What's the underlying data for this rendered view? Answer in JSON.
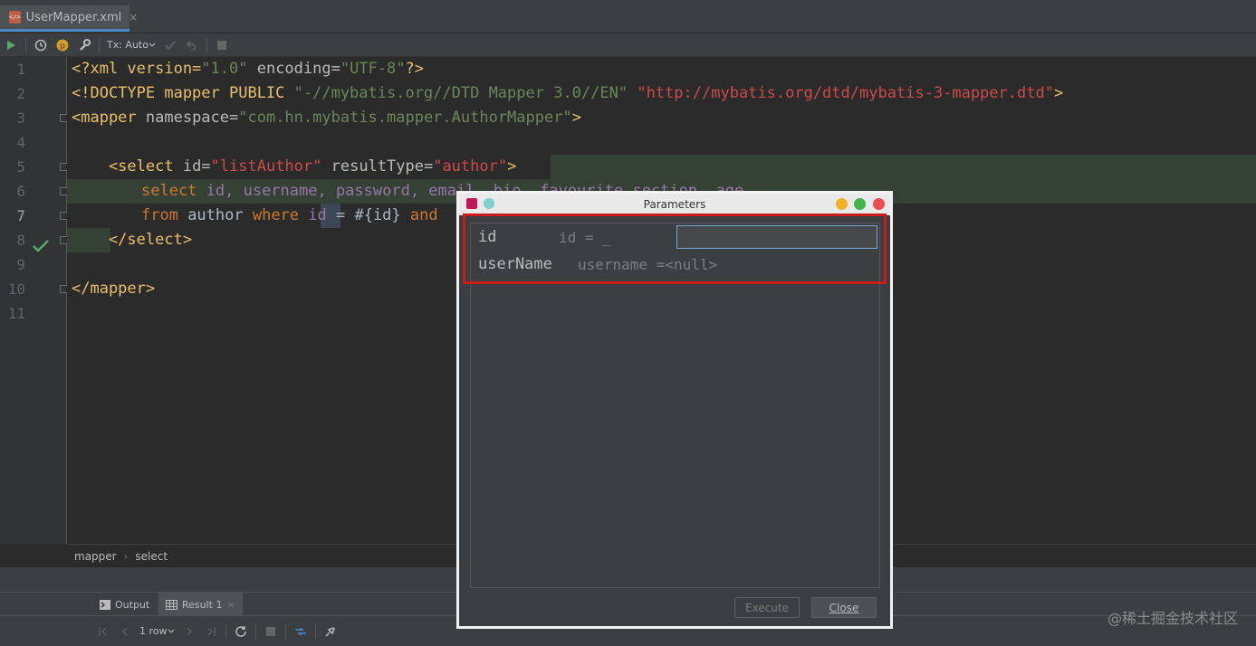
{
  "tab": {
    "filename": "UserMapper.xml",
    "close": "×"
  },
  "toolbar": {
    "tx_label": "Tx: Auto"
  },
  "lines": [
    "1",
    "2",
    "3",
    "4",
    "5",
    "6",
    "7",
    "8",
    "9",
    "10",
    "11"
  ],
  "code": {
    "l1": {
      "p1": "<?xml version=",
      "v1": "\"1.0\"",
      "p2": " encoding=",
      "v2": "\"UTF-8\"",
      "p3": "?>"
    },
    "l2": {
      "p1": "<!DOCTYPE mapper PUBLIC ",
      "v1": "\"-//mybatis.org//DTD Mapper 3.0//EN\"",
      "p2": " ",
      "v2": "\"http://mybatis.org/dtd/mybatis-3-mapper.dtd\"",
      "p3": ">"
    },
    "l3": {
      "p1": "<mapper",
      "p2": " namespace=",
      "v1": "\"com.hn.mybatis.mapper.AuthorMapper\"",
      "p3": ">"
    },
    "l5": {
      "p1": "    <select",
      "p2": " id=",
      "v1": "\"listAuthor\"",
      "p3": " resultType=",
      "v2": "\"author\"",
      "p4": ">"
    },
    "l6": {
      "k1": "select ",
      "c1": "id, username, password, email, bio, favourite_section, age"
    },
    "l7": {
      "k1": "from ",
      "p1": "author ",
      "k2": "where ",
      "c1": "id",
      "p2": " = #{id} ",
      "k3": "and"
    },
    "l8": {
      "p1": "    </select>"
    },
    "l10": {
      "p1": "</mapper>"
    }
  },
  "breadcrumb": {
    "a": "mapper",
    "sep": "›",
    "b": "select"
  },
  "runtabs": {
    "output": "Output",
    "result": "Result 1",
    "close": "×"
  },
  "results": {
    "rows": "1 row"
  },
  "watermark": "@稀土掘金技术社区",
  "dialog": {
    "title": "Parameters",
    "params": [
      {
        "name": "id",
        "value": "id = _",
        "input": ""
      },
      {
        "name": "userName",
        "value": "username =<null>"
      }
    ],
    "execute": "Execute",
    "close": "Close"
  }
}
